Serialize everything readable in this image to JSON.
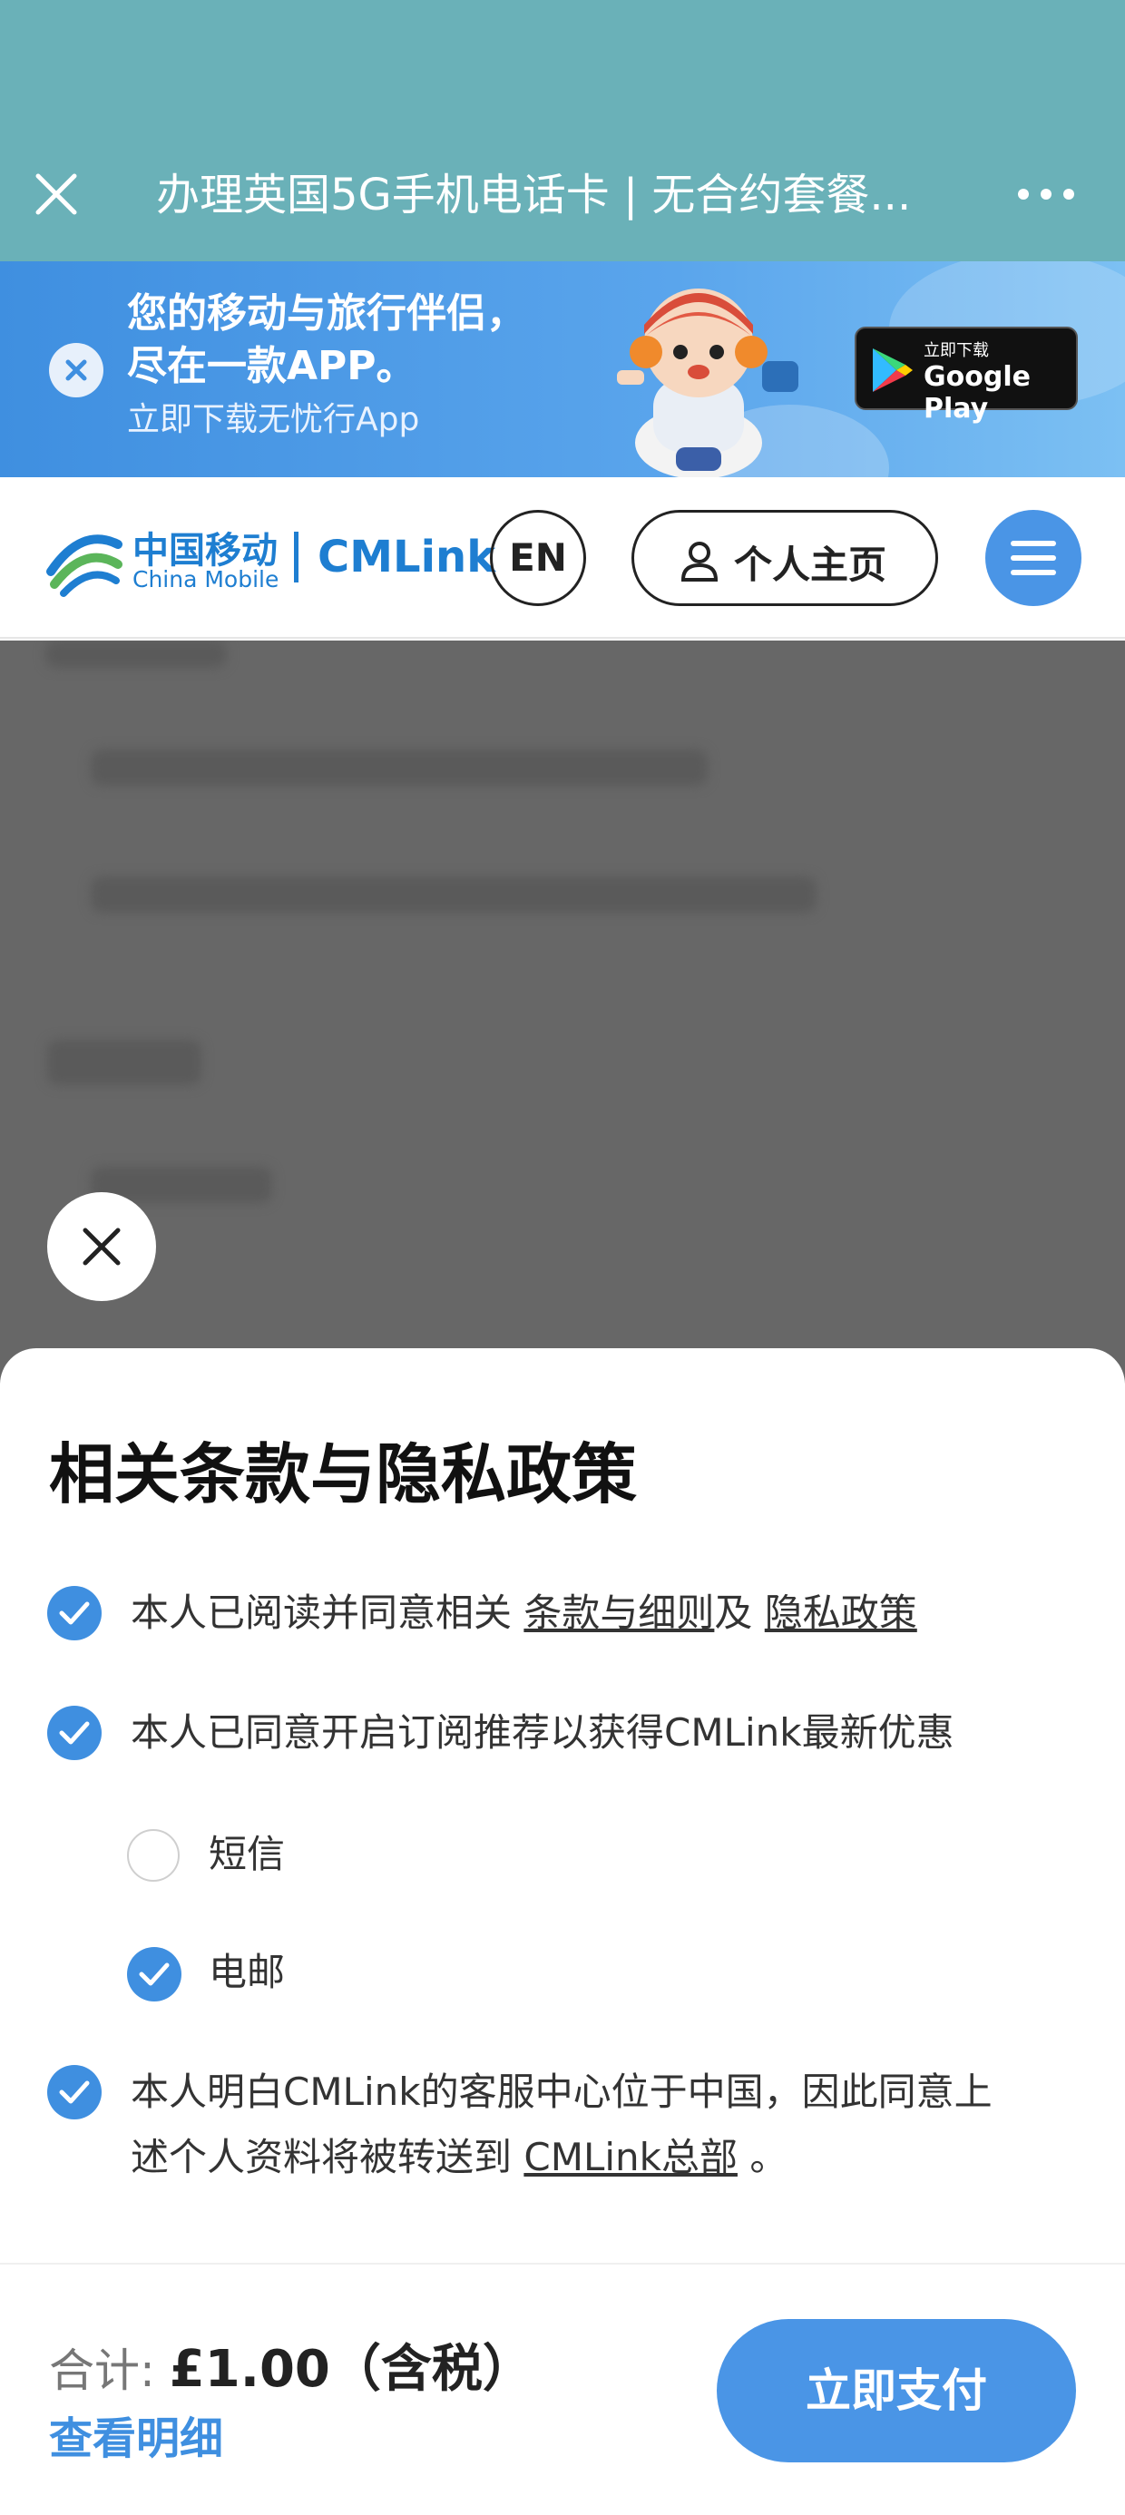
{
  "browser": {
    "title": "办理英国5G手机电话卡 | 无合约套餐..."
  },
  "banner": {
    "line1": "您的移动与旅行伴侣，",
    "line2": "尽在一款APP。",
    "line3": "立即下载无忧行App",
    "store_small": "立即下载",
    "store_big": "Google Play"
  },
  "header": {
    "logo_cn": "中国移动",
    "logo_en": "China Mobile",
    "logo_brand": "CMLink",
    "lang_label": "EN",
    "profile_label": "个人主页"
  },
  "sheet": {
    "title": "相关条款与隐私政策",
    "terms_prefix": "本人已阅读并同意相关",
    "terms_link": "条款与细则",
    "terms_and": "及",
    "privacy_link": "隐私政策",
    "subscribe_label": "本人已同意开启订阅推荐以获得CMLink最新优惠",
    "sms_label": "短信",
    "email_label": "电邮",
    "transfer_line1": "本人明白CMLink的客服中心位于中国，因此同意上",
    "transfer_prefix": "述个人资料将被转送到",
    "transfer_link": "CMLink总部",
    "transfer_suffix": "。"
  },
  "footer": {
    "total_label": "合计:",
    "total_amount": "£1.00（含税）",
    "detail_link": "查看明细",
    "pay_button": "立即支付"
  },
  "colors": {
    "topbar": "#6ab1b8",
    "accent": "#4a95e6",
    "overlay": "#676767"
  }
}
